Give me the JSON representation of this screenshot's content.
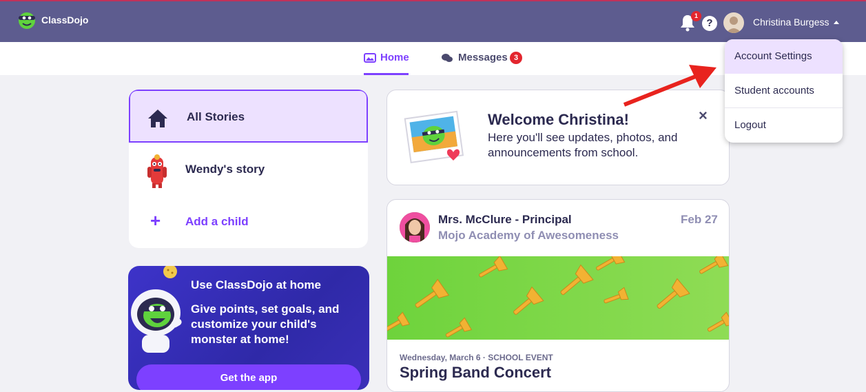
{
  "topbar": {
    "brand": "ClassDojo",
    "notification_count": "1",
    "help_label": "?",
    "user_name": "Christina Burgess"
  },
  "subnav": {
    "home_label": "Home",
    "messages_label": "Messages",
    "messages_count": "3"
  },
  "sidebar": {
    "items": [
      {
        "label": "All Stories"
      },
      {
        "label": "Wendy's story"
      },
      {
        "label": "Add a child"
      }
    ]
  },
  "promo": {
    "title": "Use ClassDojo at home",
    "body": "Give points, set goals, and customize your child's monster at home!",
    "button": "Get the app"
  },
  "welcome": {
    "title": "Welcome Christina!",
    "body": "Here you'll see updates, photos, and announcements from school.",
    "close": "×"
  },
  "post": {
    "author": "Mrs. McClure - Principal",
    "school": "Mojo Academy of Awesomeness",
    "date": "Feb 27",
    "meta": "Wednesday, March 6 · SCHOOL EVENT",
    "title": "Spring Band Concert"
  },
  "dropdown": {
    "items": [
      "Account Settings",
      "Student accounts",
      "Logout"
    ]
  },
  "colors": {
    "topbar": "#5d5c8f",
    "accent": "#7d40ff",
    "badge": "#e3262e",
    "annotation_arrow": "#e8231e"
  }
}
